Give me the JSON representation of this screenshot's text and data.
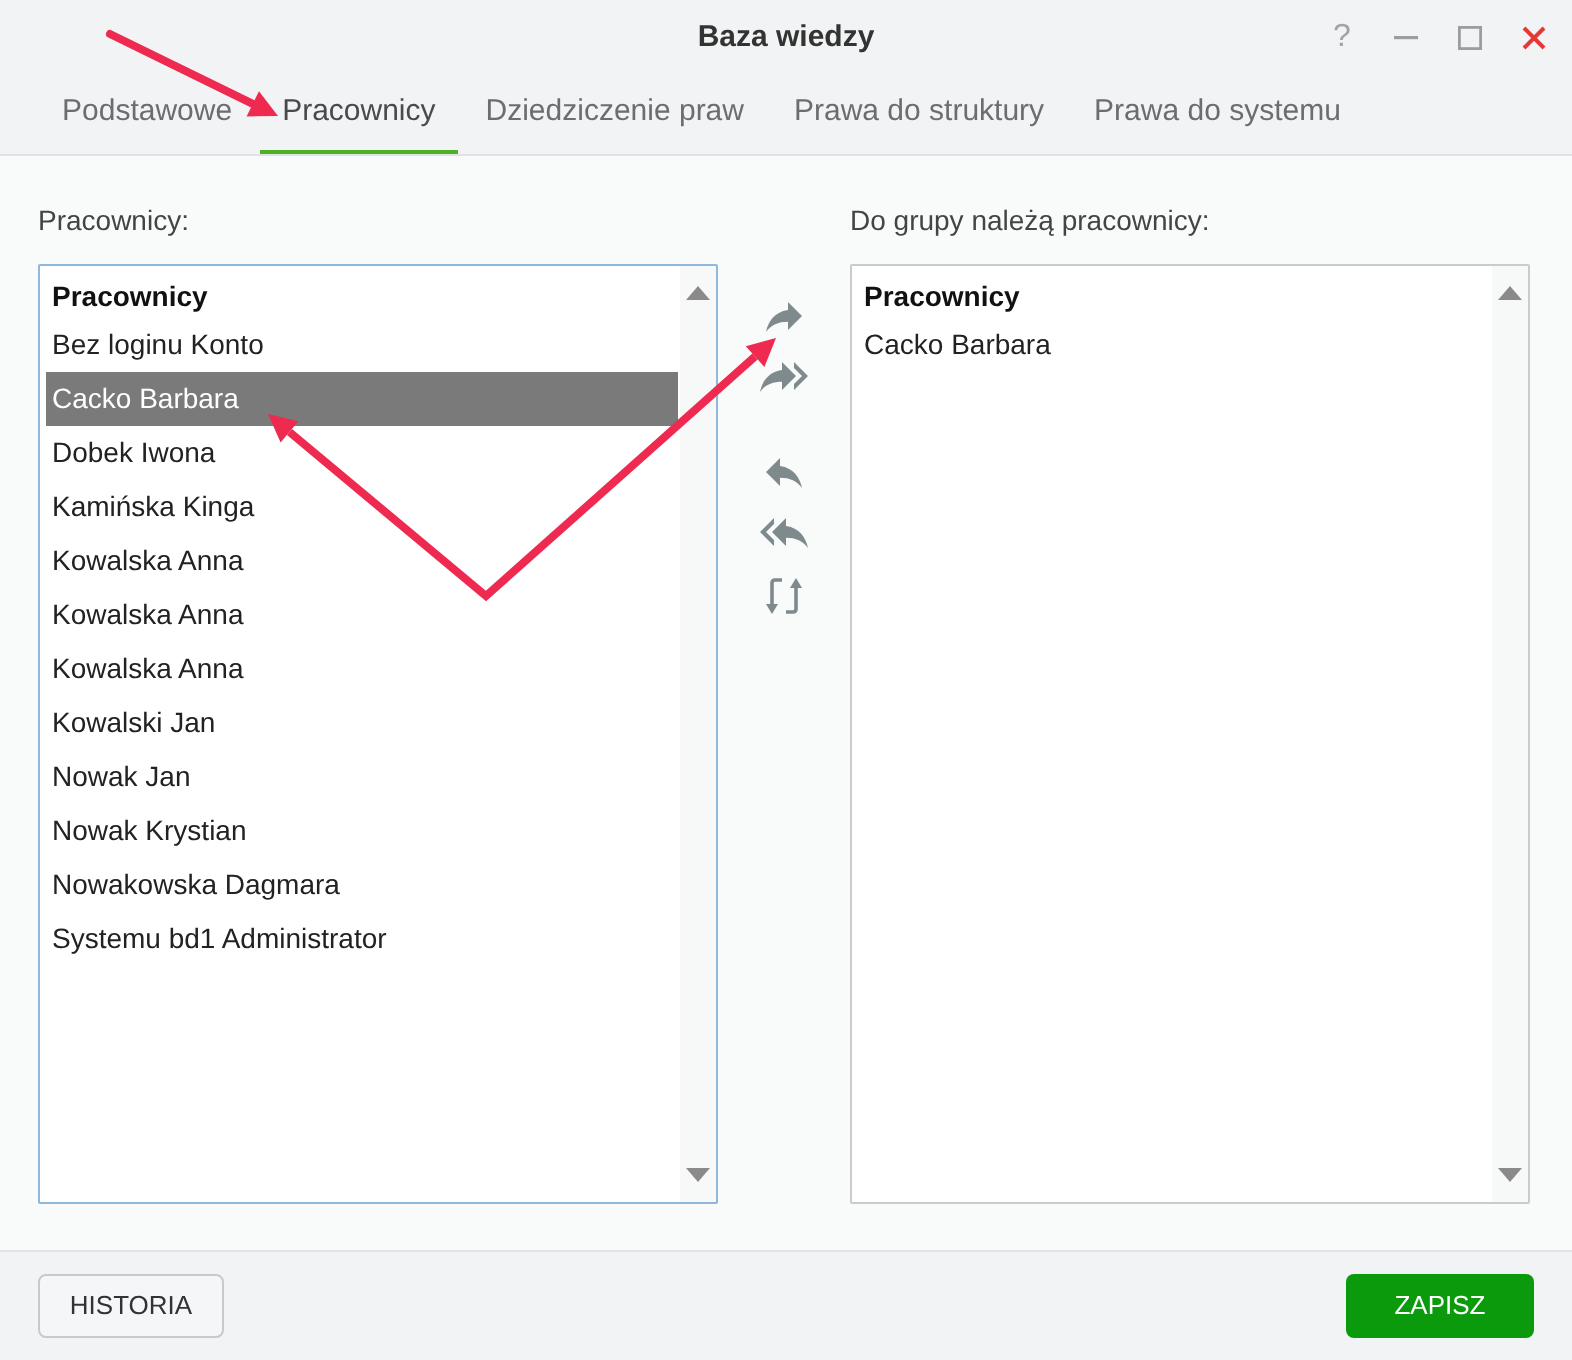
{
  "window": {
    "title": "Baza wiedzy",
    "help": "?"
  },
  "tabs": [
    {
      "label": "Podstawowe",
      "selected": false
    },
    {
      "label": "Pracownicy",
      "selected": true
    },
    {
      "label": "Dziedziczenie praw",
      "selected": false
    },
    {
      "label": "Prawa do struktury",
      "selected": false
    },
    {
      "label": "Prawa do systemu",
      "selected": false
    }
  ],
  "left_panel": {
    "label": "Pracownicy:",
    "focused": true,
    "list_header": "Pracownicy",
    "items": [
      {
        "name": "Bez loginu Konto",
        "selected": false
      },
      {
        "name": "Cacko Barbara",
        "selected": true
      },
      {
        "name": "Dobek Iwona",
        "selected": false
      },
      {
        "name": "Kamińska Kinga",
        "selected": false
      },
      {
        "name": "Kowalska Anna",
        "selected": false
      },
      {
        "name": "Kowalska Anna",
        "selected": false
      },
      {
        "name": "Kowalska Anna",
        "selected": false
      },
      {
        "name": "Kowalski Jan",
        "selected": false
      },
      {
        "name": "Nowak Jan",
        "selected": false
      },
      {
        "name": "Nowak Krystian",
        "selected": false
      },
      {
        "name": "Nowakowska Dagmara",
        "selected": false
      },
      {
        "name": "Systemu bd1 Administrator",
        "selected": false
      }
    ]
  },
  "right_panel": {
    "label": "Do grupy należą pracownicy:",
    "focused": false,
    "list_header": "Pracownicy",
    "items": [
      {
        "name": "Cacko Barbara",
        "selected": false
      }
    ]
  },
  "footer_buttons": [
    {
      "label": "HISTORIA",
      "kind": "secondary"
    },
    {
      "label": "ZAPISZ",
      "kind": "primary"
    }
  ]
}
